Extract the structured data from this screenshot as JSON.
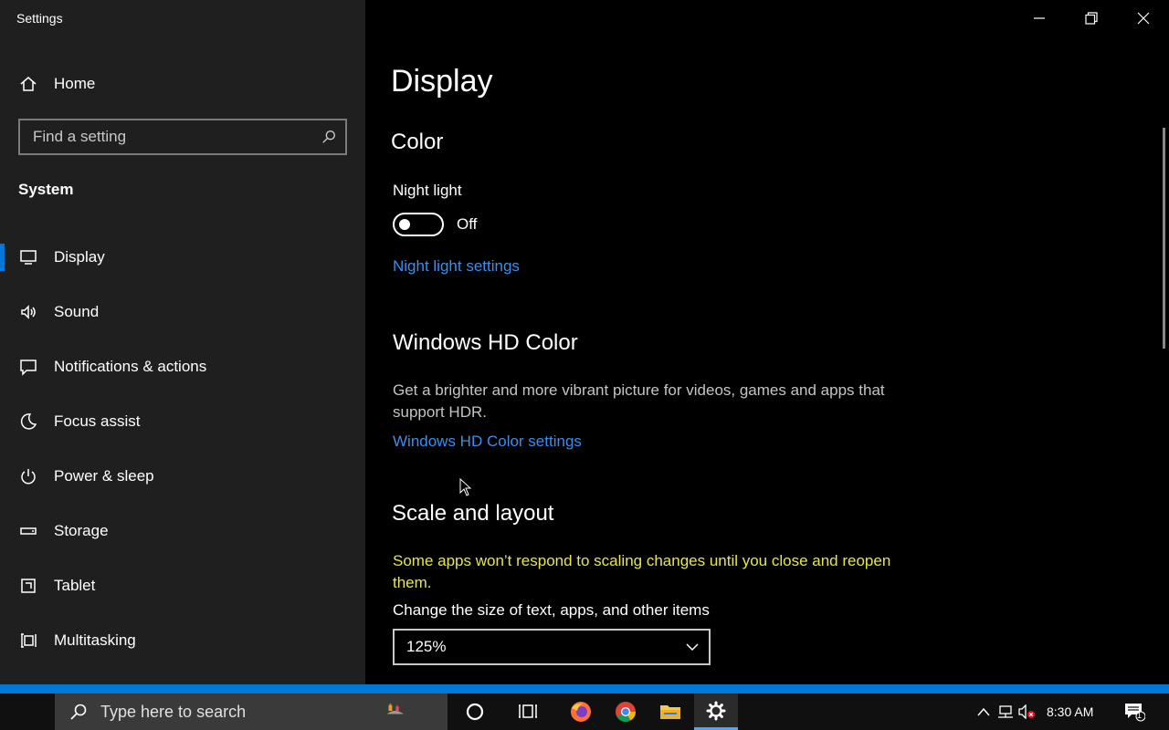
{
  "window": {
    "title": "Settings"
  },
  "sidebar": {
    "home_label": "Home",
    "search_placeholder": "Find a setting",
    "section_label": "System",
    "items": [
      {
        "label": "Display",
        "icon": "monitor-icon"
      },
      {
        "label": "Sound",
        "icon": "speaker-icon"
      },
      {
        "label": "Notifications & actions",
        "icon": "notification-icon"
      },
      {
        "label": "Focus assist",
        "icon": "moon-icon"
      },
      {
        "label": "Power & sleep",
        "icon": "power-icon"
      },
      {
        "label": "Storage",
        "icon": "storage-icon"
      },
      {
        "label": "Tablet",
        "icon": "tablet-icon"
      },
      {
        "label": "Multitasking",
        "icon": "multitasking-icon"
      }
    ],
    "active_item": "Display"
  },
  "main": {
    "page_title": "Display",
    "color": {
      "heading": "Color",
      "night_light_label": "Night light",
      "night_light_state": "Off",
      "night_light_link": "Night light settings"
    },
    "hdr": {
      "heading": "Windows HD Color",
      "description": "Get a brighter and more vibrant picture for videos, games and apps that support HDR.",
      "link": "Windows HD Color settings"
    },
    "scale": {
      "heading": "Scale and layout",
      "warning": "Some apps won’t respond to scaling changes until you close and reopen them.",
      "size_label": "Change the size of text, apps, and other items",
      "size_value": "125%"
    }
  },
  "taskbar": {
    "search_placeholder": "Type here to search",
    "time": "8:30 AM",
    "notification_count": "1"
  },
  "colors": {
    "accent": "#0078d7",
    "link": "#3b8eea",
    "warning": "#e6e64c",
    "sidebar_bg": "#1f1f1f"
  }
}
